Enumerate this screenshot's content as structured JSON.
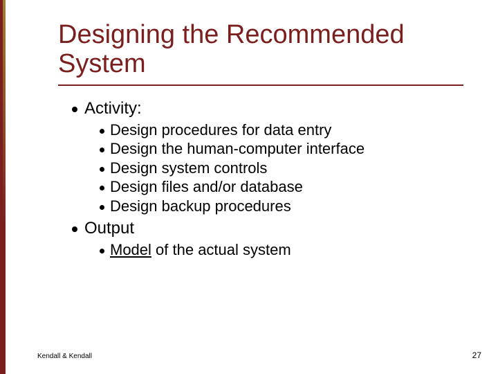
{
  "title": "Designing the Recommended System",
  "sections": [
    {
      "heading": "Activity:",
      "items": [
        {
          "text": "Design procedures for data entry"
        },
        {
          "text": "Design the human-computer interface"
        },
        {
          "text": "Design system controls"
        },
        {
          "text": "Design files and/or database"
        },
        {
          "text": "Design backup procedures"
        }
      ]
    },
    {
      "heading": "Output",
      "items": [
        {
          "text_prefix_underlined": "Model",
          "text_rest": " of the actual system"
        }
      ]
    }
  ],
  "footer_left": "Kendall & Kendall",
  "footer_right": "27",
  "colors": {
    "accent": "#7A1E1E"
  }
}
